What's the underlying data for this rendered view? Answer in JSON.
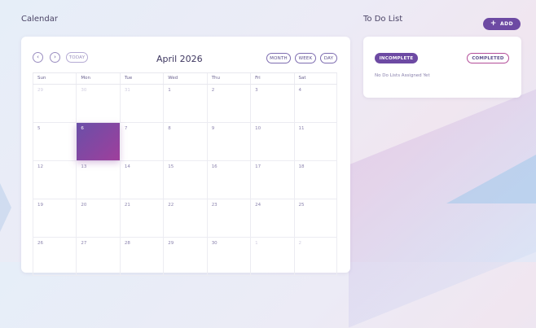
{
  "calendar": {
    "section_title": "Calendar",
    "prev_icon": "chevron-left-icon",
    "next_icon": "chevron-right-icon",
    "today_label": "TODAY",
    "month_title": "April 2026",
    "view_buttons": {
      "month": "MONTH",
      "week": "WEEK",
      "day": "DAY"
    },
    "weekdays": [
      "Sun",
      "Mon",
      "Tue",
      "Wed",
      "Thu",
      "Fri",
      "Sat"
    ],
    "weeks": [
      [
        "29",
        "30",
        "31",
        "1",
        "2",
        "3",
        "4"
      ],
      [
        "5",
        "6",
        "7",
        "8",
        "9",
        "10",
        "11"
      ],
      [
        "12",
        "13",
        "14",
        "15",
        "16",
        "17",
        "18"
      ],
      [
        "19",
        "20",
        "21",
        "22",
        "23",
        "24",
        "25"
      ],
      [
        "26",
        "27",
        "28",
        "29",
        "30",
        "1",
        "2"
      ]
    ],
    "muted_cells": [
      [
        0,
        0
      ],
      [
        0,
        1
      ],
      [
        0,
        2
      ],
      [
        4,
        5
      ],
      [
        4,
        6
      ]
    ],
    "selected_cell": [
      1,
      1
    ]
  },
  "todo": {
    "section_title": "To Do List",
    "add_label": "ADD",
    "incomplete_label": "INCOMPLETE",
    "completed_label": "COMPLETED",
    "empty_message": "No Do Lists Assigned Yet"
  },
  "colors": {
    "accent": "#6d4aa3",
    "accent_pink": "#b34c98"
  }
}
